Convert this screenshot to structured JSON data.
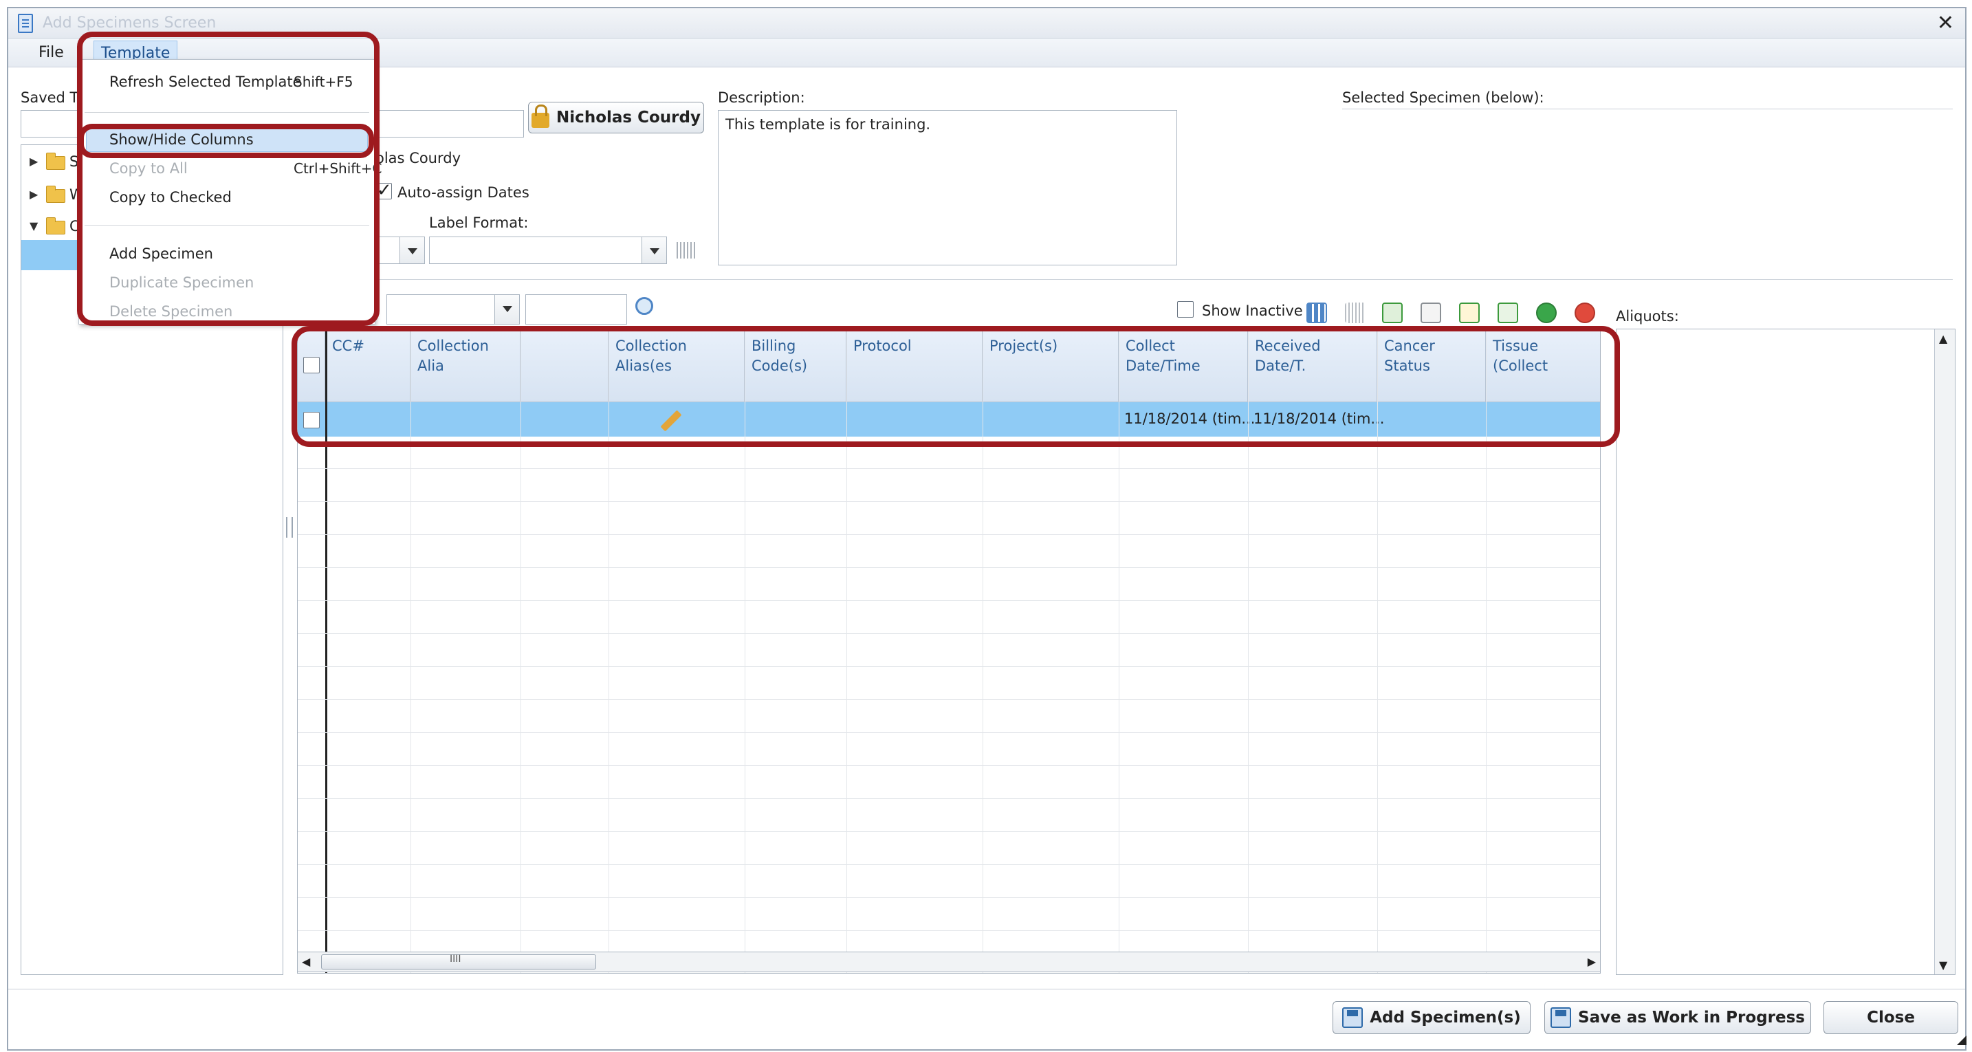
{
  "window": {
    "title": "Add Specimens Screen"
  },
  "menubar": {
    "file": "File",
    "template": "Template"
  },
  "template_menu": {
    "refresh": {
      "label": "Refresh Selected Template",
      "shortcut": "Shift+F5"
    },
    "show_hide": "Show/Hide Columns",
    "copy_all": {
      "label": "Copy to All",
      "shortcut": "Ctrl+Shift+C"
    },
    "copy_checked": "Copy to Checked",
    "add_specimen": "Add Specimen",
    "duplicate_specimen": "Duplicate Specimen",
    "delete_specimen": "Delete Specimen"
  },
  "form": {
    "saved_templates_label": "Saved T",
    "owner_button": "Nicholas Courdy",
    "owner_partial": "olas Courdy",
    "auto_assign_label": "Auto-assign Dates",
    "label_format_label": "Label Format:",
    "description_label": "Description:",
    "description_value": "This template is for training.",
    "selected_specimen_label": "Selected Specimen (below):",
    "show_inactive_label": "Show Inactive",
    "aliquots_label": "Aliquots:"
  },
  "tree": {
    "items": [
      {
        "label": "S"
      },
      {
        "label": "W"
      },
      {
        "label": "C"
      }
    ]
  },
  "grid": {
    "columns": [
      "CC#",
      "Collection Alia",
      "",
      "Collection Alias(es",
      "Billing Code(s)",
      "Protocol",
      "Project(s)",
      "Collect Date/Time",
      "Received Date/T.",
      "Cancer Status",
      "Tissue (Collect"
    ],
    "row": {
      "collect_date": "11/18/2014 (tim...",
      "received_date": "11/18/2014 (tim..."
    },
    "scroll_grip": "IIII"
  },
  "footer": {
    "add_specimens": "Add Specimen(s)",
    "save_wip": "Save as Work in Progress",
    "close": "Close"
  },
  "colors": {
    "callout": "#9e1a1f",
    "selection": "#8fcbf5",
    "header_text": "#2d5f96"
  }
}
